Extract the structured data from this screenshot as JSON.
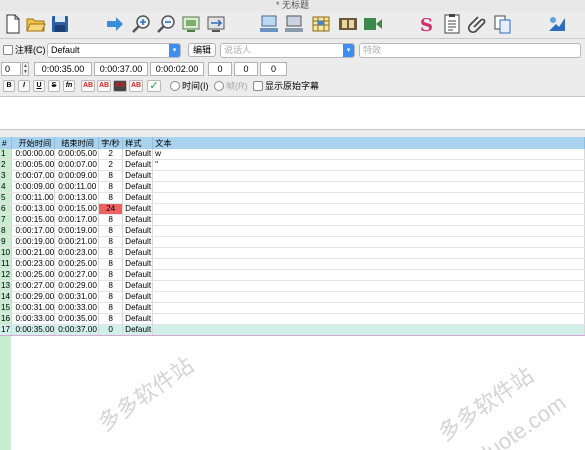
{
  "window": {
    "title": "* 无标题"
  },
  "toolbar": {
    "icons": [
      "new-file-icon",
      "open-folder-icon",
      "save-icon",
      "play-arrow-icon",
      "zoom-in-icon",
      "zoom-out-icon",
      "fit-screen-icon",
      "snap-icon",
      "video-display-icon",
      "audio-display-icon",
      "grid-icon",
      "film-icon",
      "video-audio-icon",
      "style-icon",
      "properties-icon",
      "attach-icon",
      "copy-icon",
      "automation-icon"
    ]
  },
  "row1": {
    "comment_label": "注释(C)",
    "style_value": "Default",
    "edit_label": "编辑",
    "speaker_placeholder": "说话人",
    "effect_placeholder": "特效"
  },
  "row2": {
    "layer": "0",
    "start_time": "0:00:35.00",
    "end_time": "0:00:37.00",
    "duration": "0:00:02.00",
    "margin_l": "0",
    "margin_r": "0",
    "margin_v": "0"
  },
  "row3": {
    "bold": "B",
    "italic": "I",
    "underline": "U",
    "strike": "S",
    "font": "fn",
    "color1": "AB",
    "color2": "AB",
    "color3": "AB",
    "color4": "AB",
    "time_label": "时间(I)",
    "frame_label": "帧(R)",
    "show_original_label": "显示原始字幕"
  },
  "grid": {
    "headers": [
      "#",
      "开始时间",
      "结束时间",
      "字/秒",
      "样式",
      "文本"
    ],
    "rows": [
      [
        "1",
        "0:00:00.00",
        "0:00:05.00",
        "2",
        "Default",
        "w"
      ],
      [
        "2",
        "0:00:05.00",
        "0:00:07.00",
        "2",
        "Default",
        "\""
      ],
      [
        "3",
        "0:00:07.00",
        "0:00:09.00",
        "8",
        "Default",
        ""
      ],
      [
        "4",
        "0:00:09.00",
        "0:00:11.00",
        "8",
        "Default",
        ""
      ],
      [
        "5",
        "0:00:11.00",
        "0:00:13.00",
        "8",
        "Default",
        ""
      ],
      [
        "6",
        "0:00:13.00",
        "0:00:15.00",
        "24",
        "Default",
        ""
      ],
      [
        "7",
        "0:00:15.00",
        "0:00:17.00",
        "8",
        "Default",
        ""
      ],
      [
        "8",
        "0:00:17.00",
        "0:00:19.00",
        "8",
        "Default",
        ""
      ],
      [
        "9",
        "0:00:19.00",
        "0:00:21.00",
        "8",
        "Default",
        ""
      ],
      [
        "10",
        "0:00:21.00",
        "0:00:23.00",
        "8",
        "Default",
        ""
      ],
      [
        "11",
        "0:00:23.00",
        "0:00:25.00",
        "8",
        "Default",
        ""
      ],
      [
        "12",
        "0:00:25.00",
        "0:00:27.00",
        "8",
        "Default",
        ""
      ],
      [
        "13",
        "0:00:27.00",
        "0:00:29.00",
        "8",
        "Default",
        ""
      ],
      [
        "14",
        "0:00:29.00",
        "0:00:31.00",
        "8",
        "Default",
        ""
      ],
      [
        "15",
        "0:00:31.00",
        "0:00:33.00",
        "8",
        "Default",
        ""
      ],
      [
        "16",
        "0:00:33.00",
        "0:00:35.00",
        "8",
        "Default",
        ""
      ],
      [
        "17",
        "0:00:35.00",
        "0:00:37.00",
        "0",
        "Default",
        ""
      ]
    ],
    "selected_row": 17,
    "highlight": {
      "row": 6,
      "color": "#f06060"
    }
  },
  "watermark": [
    "多多软件站",
    "duote.com"
  ],
  "colors": {
    "header_bg": "#a9d2ee",
    "sidebar_bg": "#c8ecd0",
    "accent": "#3d8ef0"
  }
}
